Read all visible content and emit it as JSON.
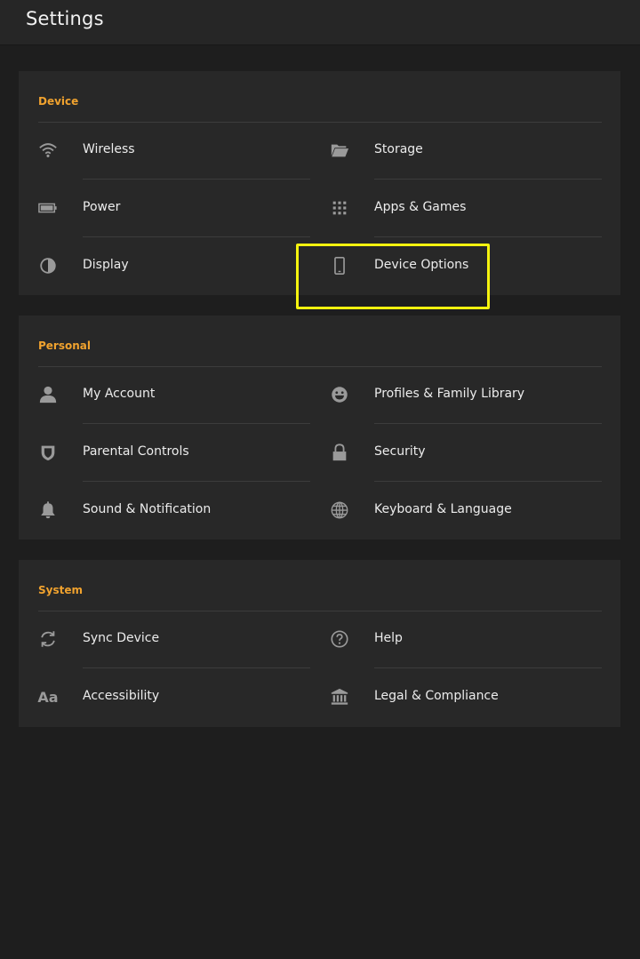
{
  "header": {
    "title": "Settings"
  },
  "sections": {
    "device": {
      "title": "Device",
      "items": [
        {
          "label": "Wireless",
          "icon": "wifi-icon"
        },
        {
          "label": "Storage",
          "icon": "folder-icon"
        },
        {
          "label": "Power",
          "icon": "battery-icon"
        },
        {
          "label": "Apps & Games",
          "icon": "apps-grid-icon"
        },
        {
          "label": "Display",
          "icon": "contrast-icon"
        },
        {
          "label": "Device Options",
          "icon": "phone-icon"
        }
      ]
    },
    "personal": {
      "title": "Personal",
      "items": [
        {
          "label": "My Account",
          "icon": "person-icon"
        },
        {
          "label": "Profiles & Family Library",
          "icon": "smiley-icon"
        },
        {
          "label": "Parental Controls",
          "icon": "shield-icon"
        },
        {
          "label": "Security",
          "icon": "lock-icon"
        },
        {
          "label": "Sound & Notification",
          "icon": "bell-icon"
        },
        {
          "label": "Keyboard & Language",
          "icon": "globe-icon"
        }
      ]
    },
    "system": {
      "title": "System",
      "items": [
        {
          "label": "Sync Device",
          "icon": "sync-icon"
        },
        {
          "label": "Help",
          "icon": "help-icon"
        },
        {
          "label": "Accessibility",
          "icon": "text-aa-icon",
          "icon_text": "Aa"
        },
        {
          "label": "Legal & Compliance",
          "icon": "building-icon"
        }
      ]
    }
  },
  "colors": {
    "accent": "#f0a22e",
    "highlight": "#f5f30f",
    "background": "#1e1e1e",
    "card": "#282828"
  }
}
